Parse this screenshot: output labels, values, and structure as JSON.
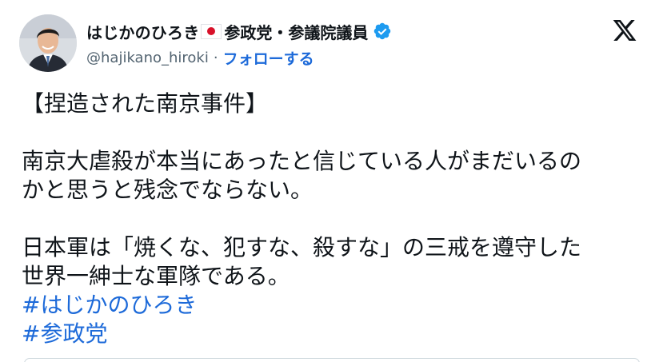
{
  "author": {
    "display_name": "はじかのひろき",
    "display_name_suffix": "参政党・参議院議員",
    "handle": "@hajikano_hiroki",
    "separator": "·",
    "follow_label": "フォローする",
    "flag_icon": "japan-flag-emoji",
    "verified_icon": "verified-badge-icon",
    "colors": {
      "verified": "#1d9bf0",
      "link": "#1d6ad9",
      "flag_red": "#d8112a"
    }
  },
  "platform": {
    "logo": "x-logo-icon"
  },
  "tweet": {
    "lines": [
      "【捏造された南京事件】",
      "",
      "南京大虐殺が本当にあったと信じている人がまだいるの",
      "かと思うと残念でならない。",
      "",
      "日本軍は「焼くな、犯すな、殺すな」の三戒を遵守した",
      "世界一紳士な軍隊である。"
    ],
    "hashtags": [
      "#はじかのひろき",
      "#参政党"
    ]
  }
}
